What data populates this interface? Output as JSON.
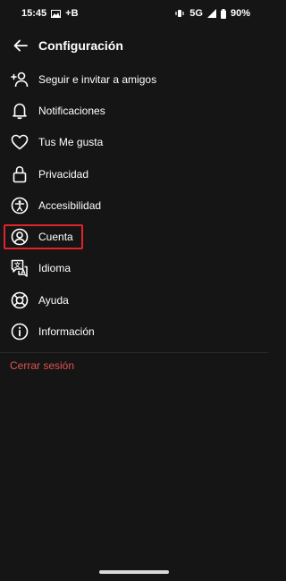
{
  "status_bar": {
    "time": "15:45",
    "extra": "+B",
    "network": "5G",
    "battery": "90%"
  },
  "header": {
    "title": "Configuración"
  },
  "menu": {
    "items": [
      {
        "label": "Seguir e invitar a amigos",
        "icon": "add-person-icon"
      },
      {
        "label": "Notificaciones",
        "icon": "bell-icon"
      },
      {
        "label": "Tus Me gusta",
        "icon": "heart-icon"
      },
      {
        "label": "Privacidad",
        "icon": "lock-icon"
      },
      {
        "label": "Accesibilidad",
        "icon": "accessibility-icon"
      },
      {
        "label": "Cuenta",
        "icon": "account-icon"
      },
      {
        "label": "Idioma",
        "icon": "language-icon"
      },
      {
        "label": "Ayuda",
        "icon": "help-icon"
      },
      {
        "label": "Información",
        "icon": "info-icon"
      }
    ]
  },
  "logout": {
    "label": "Cerrar sesión"
  },
  "colors": {
    "background": "#151515",
    "highlight": "#e0242a",
    "logout": "#e0524f"
  }
}
